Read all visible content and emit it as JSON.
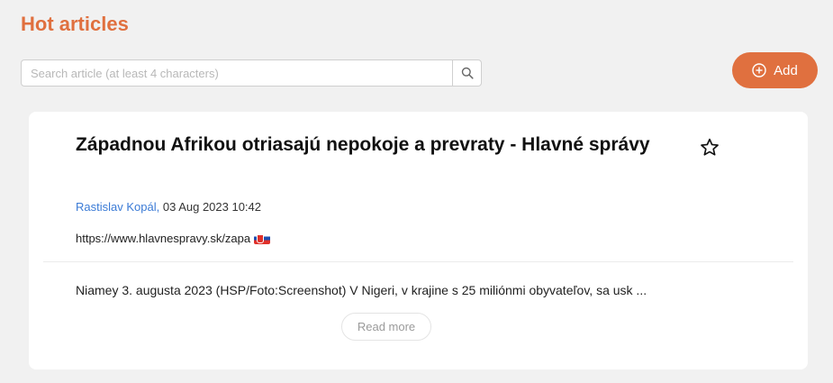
{
  "header": {
    "title": "Hot articles"
  },
  "search": {
    "placeholder": "Search article (at least 4 characters)"
  },
  "add_button": {
    "label": "Add"
  },
  "accent_color": "#e0703f",
  "article": {
    "title": "Západnou Afrikou otriasajú nepokoje a prevraty - Hlavné správy",
    "author": "Rastislav Kopál,",
    "date": "03 Aug 2023 10:42",
    "url": "https://www.hlavnespravy.sk/zapa",
    "language_flag": "slovak-flag-icon",
    "excerpt": "Niamey 3. augusta 2023 (HSP/Foto:Screenshot) V Nigeri, v krajine s 25 miliónmi obyvateľov, sa usk ...",
    "read_more_label": "Read more"
  }
}
